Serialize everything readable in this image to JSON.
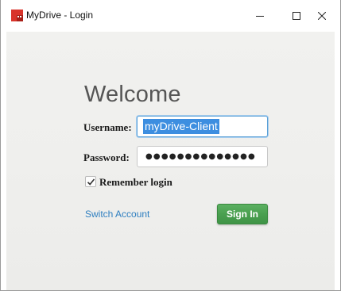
{
  "window": {
    "title": "MyDrive - Login",
    "app_icon": "mydrive-app-icon",
    "controls": {
      "minimize_icon": "minimize-icon",
      "maximize_icon": "maximize-icon",
      "close_icon": "close-icon"
    }
  },
  "login": {
    "heading": "Welcome",
    "username_label": "Username:",
    "username_value": "myDrive-Client",
    "password_label": "Password:",
    "password_mask": "●●●●●●●●●●●●●●",
    "remember_label": "Remember login",
    "remember_checked": true,
    "switch_account_label": "Switch Account",
    "sign_in_label": "Sign In"
  },
  "colors": {
    "accent_green": "#4aa050",
    "link_blue": "#2f7fc0",
    "selection_blue": "#3d8ee0",
    "app_icon_red": "#d9342b"
  }
}
